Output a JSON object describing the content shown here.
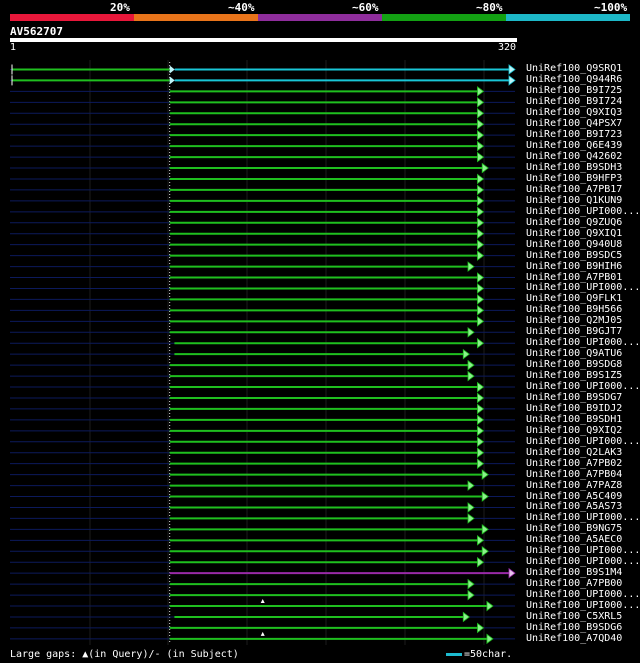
{
  "legend": {
    "labels": [
      "20%",
      "~40%",
      "~60%",
      "~80%",
      "~100%"
    ],
    "colors": [
      "#e8173a",
      "#e9741a",
      "#8f2d9c",
      "#13a113",
      "#1db8c8"
    ]
  },
  "query": {
    "name": "AV562707",
    "start_label": "1",
    "end_label": "320",
    "length": 320
  },
  "footer": {
    "gaps_text": "Large gaps: ▲(in Query)/- (in Subject)",
    "scale_text": "=50char."
  },
  "hits": [
    {
      "name": "UniRef100_Q9SRQ1",
      "start": 1,
      "end": 320,
      "color": "cyan",
      "pre_start": 1
    },
    {
      "name": "UniRef100_Q944R6",
      "start": 1,
      "end": 320,
      "color": "cyan",
      "pre_start": 1
    },
    {
      "name": "UniRef100_B9I725",
      "start": 101,
      "end": 300,
      "color": "green"
    },
    {
      "name": "UniRef100_B9I724",
      "start": 101,
      "end": 300,
      "color": "green"
    },
    {
      "name": "UniRef100_Q9XIQ3",
      "start": 101,
      "end": 300,
      "color": "green"
    },
    {
      "name": "UniRef100_Q4PSX7",
      "start": 101,
      "end": 300,
      "color": "green"
    },
    {
      "name": "UniRef100_B9I723",
      "start": 101,
      "end": 300,
      "color": "green"
    },
    {
      "name": "UniRef100_Q6E439",
      "start": 101,
      "end": 300,
      "color": "green"
    },
    {
      "name": "UniRef100_Q42602",
      "start": 101,
      "end": 300,
      "color": "green"
    },
    {
      "name": "UniRef100_B9SDH3",
      "start": 101,
      "end": 303,
      "color": "green"
    },
    {
      "name": "UniRef100_B9HFP3",
      "start": 101,
      "end": 300,
      "color": "green"
    },
    {
      "name": "UniRef100_A7PB17",
      "start": 101,
      "end": 300,
      "color": "green"
    },
    {
      "name": "UniRef100_Q1KUN9",
      "start": 101,
      "end": 300,
      "color": "green"
    },
    {
      "name": "UniRef100_UPI000...",
      "start": 101,
      "end": 300,
      "color": "green"
    },
    {
      "name": "UniRef100_Q9ZUQ6",
      "start": 101,
      "end": 300,
      "color": "green"
    },
    {
      "name": "UniRef100_Q9XIQ1",
      "start": 101,
      "end": 300,
      "color": "green"
    },
    {
      "name": "UniRef100_Q940U8",
      "start": 101,
      "end": 300,
      "color": "green"
    },
    {
      "name": "UniRef100_B9SDC5",
      "start": 101,
      "end": 300,
      "color": "green"
    },
    {
      "name": "UniRef100_B9HIH6",
      "start": 101,
      "end": 294,
      "color": "green"
    },
    {
      "name": "UniRef100_A7PB01",
      "start": 101,
      "end": 300,
      "color": "green"
    },
    {
      "name": "UniRef100_UPI000...",
      "start": 101,
      "end": 300,
      "color": "green"
    },
    {
      "name": "UniRef100_Q9FLK1",
      "start": 101,
      "end": 300,
      "color": "green"
    },
    {
      "name": "UniRef100_B9H566",
      "start": 101,
      "end": 300,
      "color": "green"
    },
    {
      "name": "UniRef100_Q2MJ05",
      "start": 101,
      "end": 300,
      "color": "green"
    },
    {
      "name": "UniRef100_B9GJT7",
      "start": 101,
      "end": 294,
      "color": "green"
    },
    {
      "name": "UniRef100_UPI000...",
      "start": 104,
      "end": 300,
      "color": "green"
    },
    {
      "name": "UniRef100_Q9ATU6",
      "start": 104,
      "end": 291,
      "color": "green"
    },
    {
      "name": "UniRef100_B9SDG8",
      "start": 101,
      "end": 294,
      "color": "green"
    },
    {
      "name": "UniRef100_B9S1Z5",
      "start": 101,
      "end": 294,
      "color": "green"
    },
    {
      "name": "UniRef100_UPI000...",
      "start": 101,
      "end": 300,
      "color": "green"
    },
    {
      "name": "UniRef100_B9SDG7",
      "start": 101,
      "end": 300,
      "color": "green"
    },
    {
      "name": "UniRef100_B9IDJ2",
      "start": 101,
      "end": 300,
      "color": "green"
    },
    {
      "name": "UniRef100_B9SDH1",
      "start": 101,
      "end": 300,
      "color": "green"
    },
    {
      "name": "UniRef100_Q9XIQ2",
      "start": 101,
      "end": 300,
      "color": "green"
    },
    {
      "name": "UniRef100_UPI000...",
      "start": 101,
      "end": 300,
      "color": "green"
    },
    {
      "name": "UniRef100_Q2LAK3",
      "start": 101,
      "end": 300,
      "color": "green"
    },
    {
      "name": "UniRef100_A7PB02",
      "start": 101,
      "end": 300,
      "color": "green"
    },
    {
      "name": "UniRef100_A7PB04",
      "start": 101,
      "end": 303,
      "color": "green"
    },
    {
      "name": "UniRef100_A7PAZ8",
      "start": 101,
      "end": 294,
      "color": "green"
    },
    {
      "name": "UniRef100_A5C409",
      "start": 101,
      "end": 303,
      "color": "green"
    },
    {
      "name": "UniRef100_A5AS73",
      "start": 101,
      "end": 294,
      "color": "green"
    },
    {
      "name": "UniRef100_UPI000...",
      "start": 101,
      "end": 294,
      "color": "green"
    },
    {
      "name": "UniRef100_B9NG75",
      "start": 101,
      "end": 303,
      "color": "green"
    },
    {
      "name": "UniRef100_A5AEC0",
      "start": 101,
      "end": 300,
      "color": "green"
    },
    {
      "name": "UniRef100_UPI000...",
      "start": 101,
      "end": 303,
      "color": "green"
    },
    {
      "name": "UniRef100_UPI000...",
      "start": 101,
      "end": 300,
      "color": "green"
    },
    {
      "name": "UniRef100_B9S1M4",
      "start": 101,
      "end": 320,
      "color": "purple"
    },
    {
      "name": "UniRef100_A7PB00",
      "start": 101,
      "end": 294,
      "color": "green"
    },
    {
      "name": "UniRef100_UPI000...",
      "start": 101,
      "end": 294,
      "color": "green"
    },
    {
      "name": "UniRef100_UPI000...",
      "start": 101,
      "end": 306,
      "color": "green",
      "gap_marker": 160
    },
    {
      "name": "UniRef100_C5XRL5",
      "start": 104,
      "end": 291,
      "color": "green"
    },
    {
      "name": "UniRef100_B9SDG6",
      "start": 101,
      "end": 300,
      "color": "green"
    },
    {
      "name": "UniRef100_A7QD40",
      "start": 101,
      "end": 306,
      "color": "green",
      "gap_marker": 160
    }
  ]
}
